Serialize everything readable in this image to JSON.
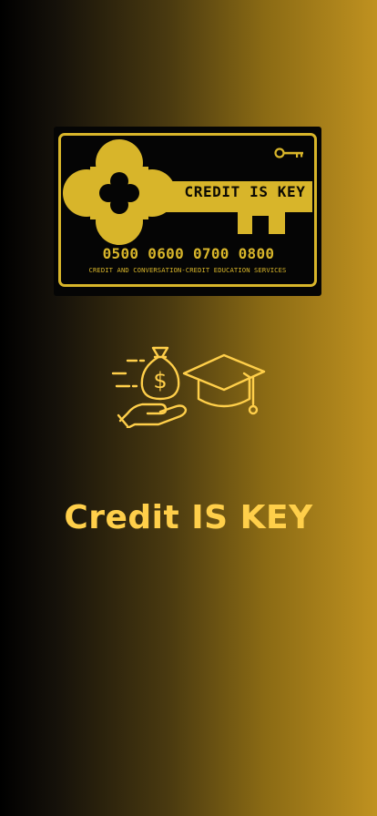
{
  "card": {
    "title": "CREDIT IS KEY",
    "number": "0500 0600 0700 0800",
    "services": "CREDIT AND CONVERSATION-CREDIT EDUCATION SERVICES"
  },
  "icons": {
    "card_emblem": "key-logo-icon",
    "small_key": "key-icon",
    "education": "money-bag-graduation-cap-icon"
  },
  "headline": "Credit IS KEY",
  "colors": {
    "gold": "#d8b52a",
    "headline": "#ffcf4a",
    "card_background": "#050505"
  }
}
